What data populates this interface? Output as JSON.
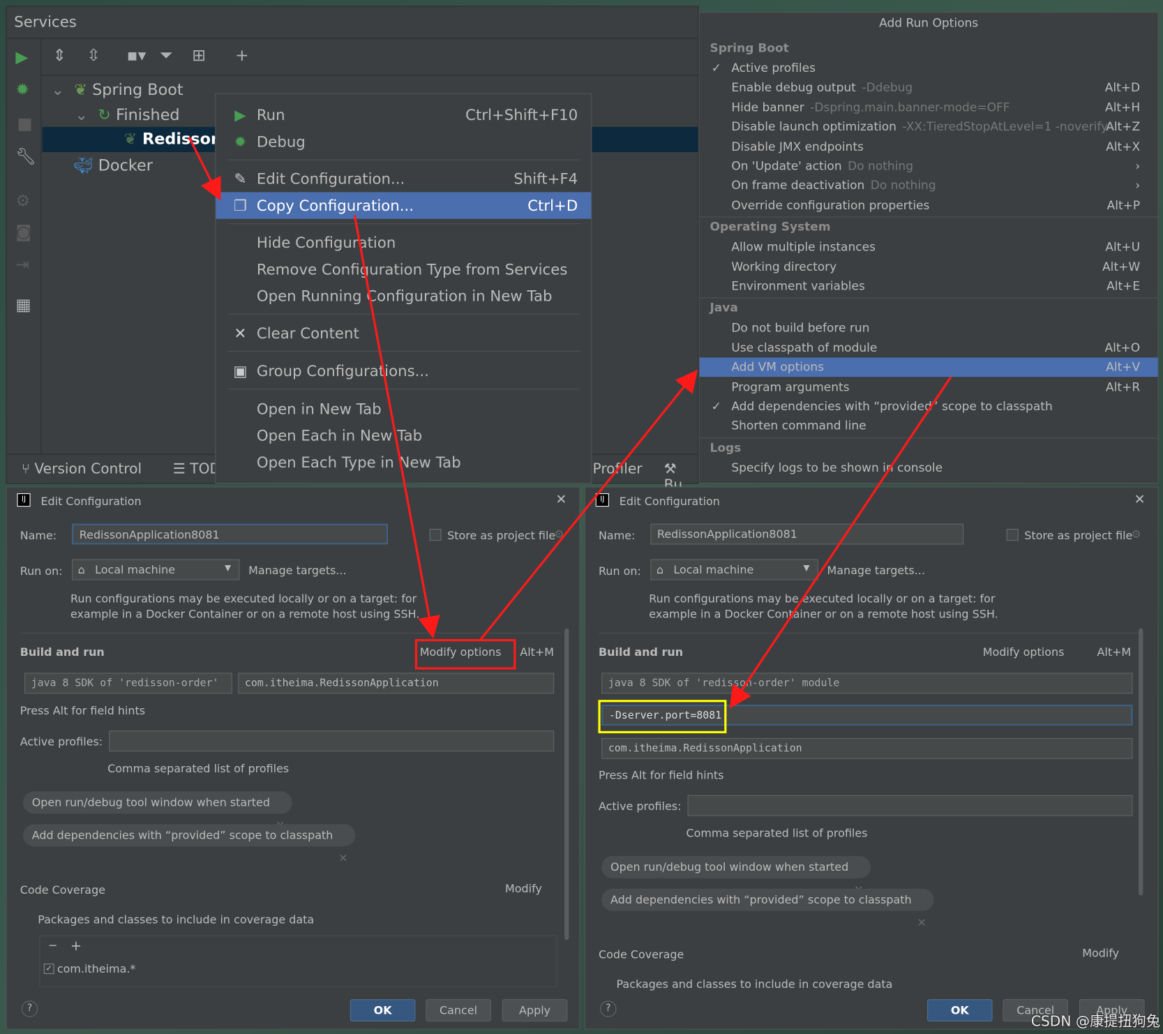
{
  "services": {
    "title": "Services",
    "tree": [
      {
        "label": "Spring Boot"
      },
      {
        "label": "Finished"
      },
      {
        "label": "RedissonA"
      },
      {
        "label": "Docker"
      }
    ],
    "bottom_tabs": [
      {
        "label": "Version Control"
      },
      {
        "label": "TOD"
      },
      {
        "label": "Profiler"
      },
      {
        "label": "Bu"
      }
    ]
  },
  "context_menu": {
    "items": [
      {
        "label": "Run",
        "shortcut": "Ctrl+Shift+F10",
        "icon": "run-icon"
      },
      {
        "label": "Debug",
        "shortcut": "",
        "icon": "debug-icon"
      },
      {
        "label": "Edit Configuration...",
        "shortcut": "Shift+F4",
        "icon": "edit-icon"
      },
      {
        "label": "Copy Configuration...",
        "shortcut": "Ctrl+D",
        "icon": "copy-icon",
        "selected": true
      },
      {
        "label": "Hide Configuration",
        "shortcut": ""
      },
      {
        "label": "Remove Configuration Type from Services",
        "shortcut": ""
      },
      {
        "label": "Open Running Configuration in New Tab",
        "shortcut": ""
      },
      {
        "label": "Clear Content",
        "shortcut": "",
        "icon": "close-icon"
      },
      {
        "label": "Group Configurations...",
        "shortcut": "",
        "icon": "folder-icon"
      },
      {
        "label": "Open in New Tab",
        "shortcut": ""
      },
      {
        "label": "Open Each in New Tab",
        "shortcut": ""
      },
      {
        "label": "Open Each Type in New Tab",
        "shortcut": ""
      }
    ]
  },
  "run_options": {
    "title": "Add Run Options",
    "groups": [
      {
        "name": "Spring Boot",
        "items": [
          {
            "label": "Active profiles",
            "checked": true
          },
          {
            "label": "Enable debug output",
            "hint": "-Ddebug",
            "shortcut": "Alt+D"
          },
          {
            "label": "Hide banner",
            "hint": "-Dspring.main.banner-mode=OFF",
            "shortcut": "Alt+H"
          },
          {
            "label": "Disable launch optimization",
            "hint": "-XX:TieredStopAtLevel=1 -noverify",
            "shortcut": "Alt+Z"
          },
          {
            "label": "Disable JMX endpoints",
            "shortcut": "Alt+X"
          },
          {
            "label": "On 'Update' action",
            "hint": "Do nothing",
            "shortcut": "›"
          },
          {
            "label": "On frame deactivation",
            "hint": "Do nothing",
            "shortcut": "›"
          },
          {
            "label": "Override configuration properties",
            "shortcut": "Alt+P"
          }
        ]
      },
      {
        "name": "Operating System",
        "items": [
          {
            "label": "Allow multiple instances",
            "shortcut": "Alt+U"
          },
          {
            "label": "Working directory",
            "shortcut": "Alt+W"
          },
          {
            "label": "Environment variables",
            "shortcut": "Alt+E"
          }
        ]
      },
      {
        "name": "Java",
        "items": [
          {
            "label": "Do not build before run"
          },
          {
            "label": "Use classpath of module",
            "shortcut": "Alt+O"
          },
          {
            "label": "Add VM options",
            "shortcut": "Alt+V",
            "selected": true
          },
          {
            "label": "Program arguments",
            "shortcut": "Alt+R"
          },
          {
            "label": "Add dependencies with “provided” scope to classpath",
            "checked": true
          },
          {
            "label": "Shorten command line"
          }
        ]
      },
      {
        "name": "Logs",
        "items": [
          {
            "label": "Specify logs to be shown in console"
          }
        ]
      }
    ]
  },
  "dialog": {
    "title": "Edit Configuration",
    "name_label": "Name:",
    "name_value": "RedissonApplication8081",
    "store_label": "Store as project file",
    "run_on_label": "Run on:",
    "run_on_value": "Local machine",
    "manage_targets": "Manage targets...",
    "run_hint": "Run configurations may be executed locally or on a target: for\nexample in a Docker Container or on a remote host using SSH.",
    "build_and_run": "Build and run",
    "modify_options": "Modify options",
    "modify_shortcut": "Alt+M",
    "sdk_short": "java 8 SDK of 'redisson-order'",
    "sdk_full": "java 8 SDK of 'redisson-order' module",
    "main_class": "com.itheima.RedissonApplication",
    "vm_options": "-Dserver.port=8081",
    "field_hints": "Press Alt for field hints",
    "active_profiles_label": "Active profiles:",
    "profiles_hint": "Comma separated list of profiles",
    "chips": [
      {
        "label": "Open run/debug tool window when started"
      },
      {
        "label": "Add dependencies with “provided” scope to classpath"
      }
    ],
    "code_coverage": "Code Coverage",
    "modify": "Modify",
    "packages_label": "Packages and classes to include in coverage data",
    "package_entry": "com.itheima.*",
    "ok": "OK",
    "cancel": "Cancel",
    "apply": "Apply"
  },
  "watermark": "CSDN @康提扭狗兔",
  "colors": {
    "selection": "#4b6eaf",
    "annotation_red": "#ff1a1a",
    "annotation_yellow": "#ffff00"
  }
}
